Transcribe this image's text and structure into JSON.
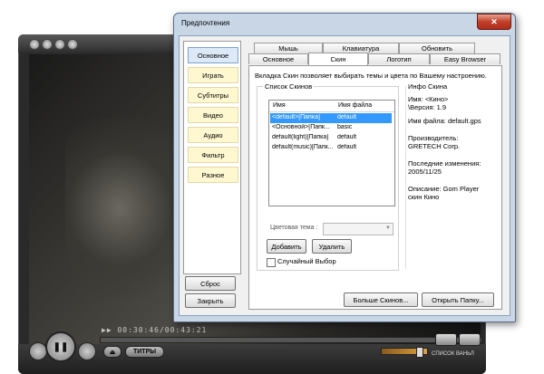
{
  "player": {
    "time_display": "▶▶ 00:30:46/00:43:21",
    "titles_button": "ТИТРЫ",
    "eject_button": "⏏",
    "playlist_label": "СПИСОК ВАНЬЛ"
  },
  "window": {
    "title": "Предпочтения",
    "close_glyph": "✕"
  },
  "nav": {
    "items": [
      "Основное",
      "Играть",
      "Субтитры",
      "Видео",
      "Аудио",
      "Фильтр",
      "Разное"
    ],
    "reset_button": "Сброс",
    "close_button": "Закрыть"
  },
  "tabs": {
    "row1": [
      "Мышь",
      "Клавиатура",
      "Обновить"
    ],
    "row2": [
      "Основное",
      "Скин",
      "Логотип",
      "Easy Browser"
    ],
    "active": "Скин"
  },
  "skin": {
    "description": "Вкладка Скин позволяет выбирать темы и цвета по Вашему настроению.",
    "list_group_label": "Список Скинов",
    "col_name": "Имя",
    "col_file": "Имя файла",
    "rows": [
      {
        "name": "<default>[Папка]",
        "file": "default",
        "selected": true
      },
      {
        "name": "<Основной>[Папк...",
        "file": "basic",
        "selected": false
      },
      {
        "name": "default(light)[Папка]",
        "file": "default",
        "selected": false
      },
      {
        "name": "default(music)[Папк...",
        "file": "default",
        "selected": false
      }
    ],
    "color_theme_label": "Цветовая тема :",
    "color_theme_value": "",
    "add_button": "Добавить",
    "delete_button": "Удалить",
    "random_label": "Случайный Выбор",
    "random_checked": false,
    "more_skins_button": "Больше Скинов...",
    "open_folder_button": "Открыть Папку..."
  },
  "info": {
    "title": "Инфо Скина",
    "name_line1": "Имя: <Кино>",
    "name_line2": "\\Версия: 1.9",
    "filename": "Имя файла: default.gps",
    "producer_label": "Производитель:",
    "producer": "GRETECH Corp.",
    "modified_label": "Последние изменения:",
    "modified": "2005/11/25",
    "description_line1": "Описание: Gom Player",
    "description_line2": "скин Кино"
  }
}
